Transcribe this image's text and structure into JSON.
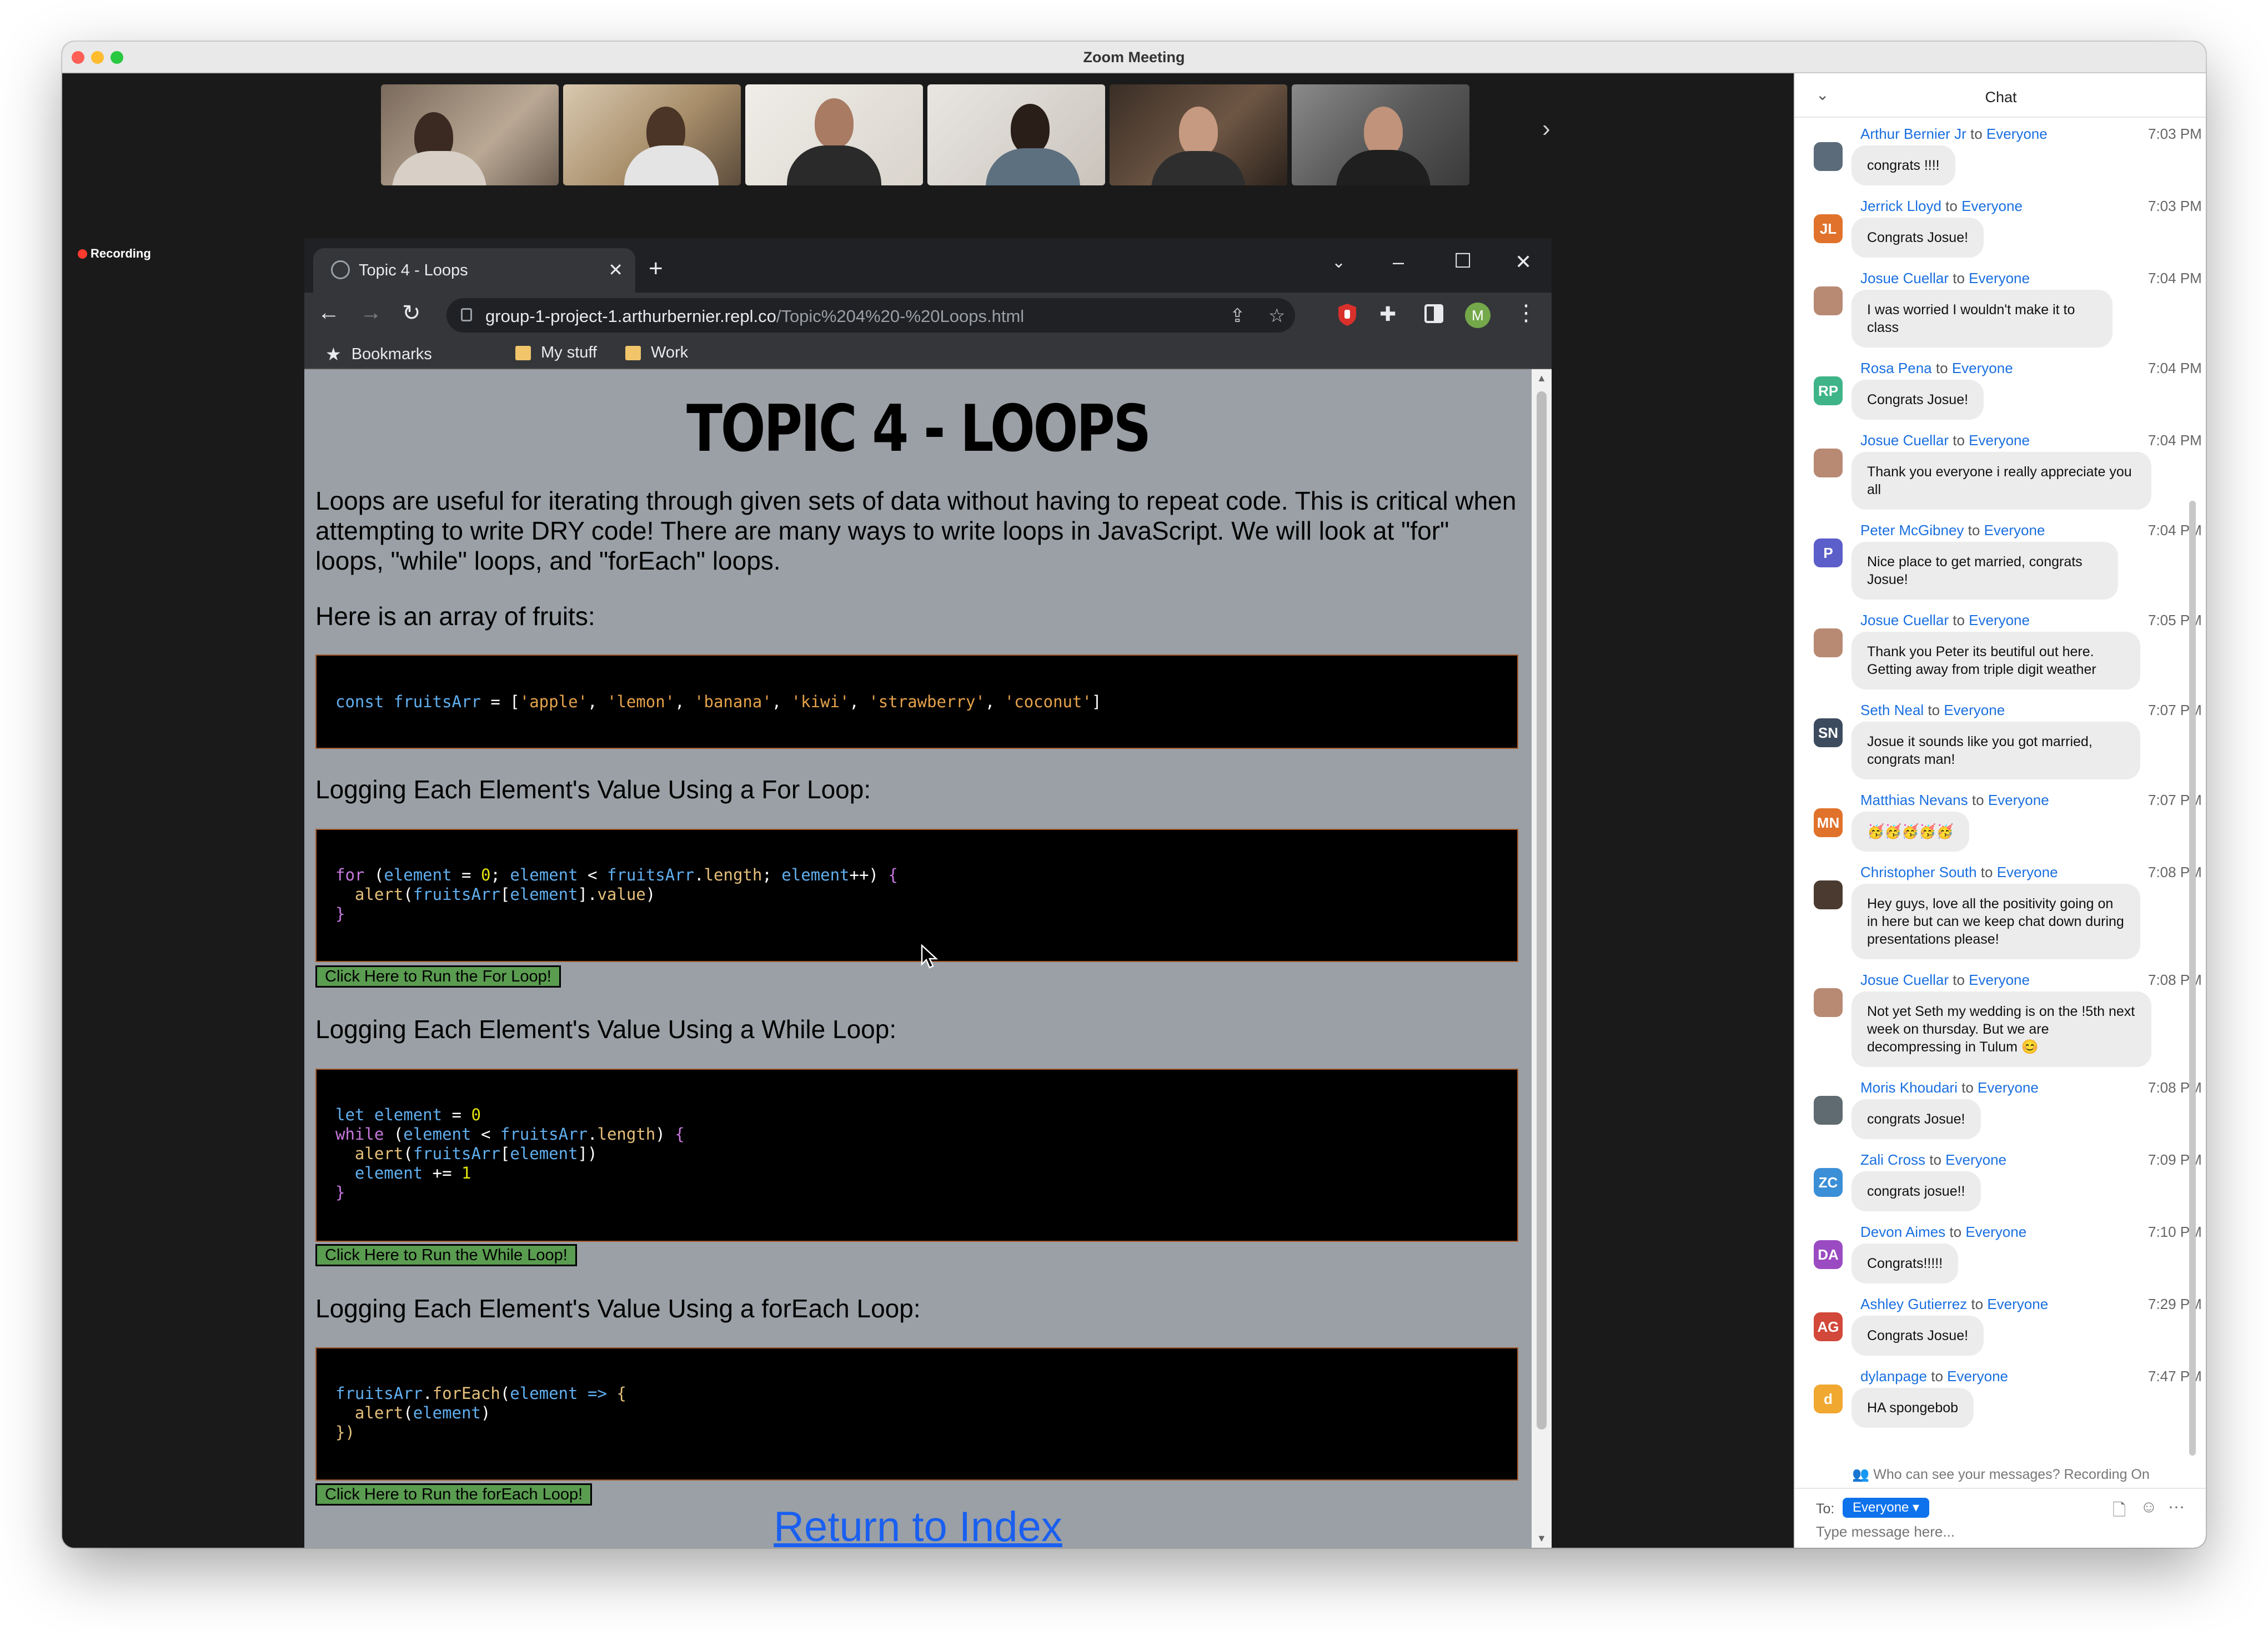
{
  "app": {
    "window_title": "Zoom Meeting",
    "recording_label": "Recording"
  },
  "participants_next": "›",
  "browser": {
    "tab_title": "Topic 4 - Loops",
    "tab_close": "✕",
    "new_tab": "+",
    "url_host": "group-1-project-1.arthurbernier.repl.co",
    "url_path": "/Topic%204%20-%20Loops.html",
    "profile_initial": "M",
    "bookmarks": [
      {
        "label": "Bookmarks"
      },
      {
        "label": "My stuff"
      },
      {
        "label": "Work"
      }
    ]
  },
  "page": {
    "title": "TOPIC 4 - LOOPS",
    "intro": "Loops are useful for iterating through given sets of data without having to repeat code. This is critical when attempting to write DRY code! There are many ways to write loops in JavaScript. We will look at \"for\" loops, \"while\" loops, and \"forEach\" loops.",
    "array_heading": "Here is an array of fruits:",
    "array_code": {
      "kw": "const",
      "var": "fruitsArr",
      "eq": " = [",
      "items": [
        "'apple'",
        "'lemon'",
        "'banana'",
        "'kiwi'",
        "'strawberry'",
        "'coconut'"
      ],
      "close": "]"
    },
    "for_heading": "Logging Each Element's Value Using a For Loop:",
    "for_button": "Click Here to Run the For Loop!",
    "while_heading": "Logging Each Element's Value Using a While Loop:",
    "while_button": "Click Here to Run the While Loop!",
    "foreach_heading": "Logging Each Element's Value Using a forEach Loop:",
    "foreach_button": "Click Here to Run the forEach Loop!",
    "return_link": "Return to Index"
  },
  "chat": {
    "title": "Chat",
    "notice": "Who can see your messages? Recording On",
    "to_label": "To:",
    "to_value": "Everyone ▾",
    "input_placeholder": "Type message here...",
    "messages": [
      {
        "sender": "Arthur Bernier Jr",
        "to": "to",
        "recipient": "Everyone",
        "time": "7:03 PM",
        "avatar": "",
        "avatar_color": "#5b6b7a",
        "text": "congrats !!!!"
      },
      {
        "sender": "Jerrick Lloyd",
        "to": "to",
        "recipient": "Everyone",
        "time": "7:03 PM",
        "avatar": "JL",
        "avatar_color": "#e0722b",
        "text": "Congrats Josue!"
      },
      {
        "sender": "Josue Cuellar",
        "to": "to",
        "recipient": "Everyone",
        "time": "7:04 PM",
        "avatar": "",
        "avatar_color": "#b88a74",
        "text": "I was worried I wouldn't make it to class"
      },
      {
        "sender": "Rosa Pena",
        "to": "to",
        "recipient": "Everyone",
        "time": "7:04 PM",
        "avatar": "RP",
        "avatar_color": "#3fb489",
        "text": "Congrats Josue!"
      },
      {
        "sender": "Josue Cuellar",
        "to": "to",
        "recipient": "Everyone",
        "time": "7:04 PM",
        "avatar": "",
        "avatar_color": "#b88a74",
        "text": "Thank you everyone i really appreciate you all"
      },
      {
        "sender": "Peter McGibney",
        "to": "to",
        "recipient": "Everyone",
        "time": "7:04 PM",
        "avatar": "P",
        "avatar_color": "#5c5ec9",
        "text": "Nice place to get married, congrats Josue!"
      },
      {
        "sender": "Josue Cuellar",
        "to": "to",
        "recipient": "Everyone",
        "time": "7:05 PM",
        "avatar": "",
        "avatar_color": "#b88a74",
        "text": "Thank you Peter its beutiful out here. Getting away from triple digit weather"
      },
      {
        "sender": "Seth Neal",
        "to": "to",
        "recipient": "Everyone",
        "time": "7:07 PM",
        "avatar": "SN",
        "avatar_color": "#3c4b5e",
        "text": "Josue it sounds like you got married, congrats man!"
      },
      {
        "sender": "Matthias Nevans",
        "to": "to",
        "recipient": "Everyone",
        "time": "7:07 PM",
        "avatar": "MN",
        "avatar_color": "#e0722b",
        "text": "🥳🥳🥳🥳🥳"
      },
      {
        "sender": "Christopher South",
        "to": "to",
        "recipient": "Everyone",
        "time": "7:08 PM",
        "avatar": "",
        "avatar_color": "#4a3a30",
        "text": "Hey guys, love all the positivity going on in here but can we keep chat down during presentations please!"
      },
      {
        "sender": "Josue Cuellar",
        "to": "to",
        "recipient": "Everyone",
        "time": "7:08 PM",
        "avatar": "",
        "avatar_color": "#b88a74",
        "text": "Not yet Seth my wedding is on the !5th next week on thursday. But we are decompressing in Tulum 😊"
      },
      {
        "sender": "Moris Khoudari",
        "to": "to",
        "recipient": "Everyone",
        "time": "7:08 PM",
        "avatar": "",
        "avatar_color": "#5f6b70",
        "text": "congrats Josue!"
      },
      {
        "sender": "Zali Cross",
        "to": "to",
        "recipient": "Everyone",
        "time": "7:09 PM",
        "avatar": "ZC",
        "avatar_color": "#3b8fd6",
        "text": "congrats josue!!"
      },
      {
        "sender": "Devon Aimes",
        "to": "to",
        "recipient": "Everyone",
        "time": "7:10 PM",
        "avatar": "DA",
        "avatar_color": "#9b4bc2",
        "text": "Congrats!!!!!"
      },
      {
        "sender": "Ashley Gutierrez",
        "to": "to",
        "recipient": "Everyone",
        "time": "7:29 PM",
        "avatar": "AG",
        "avatar_color": "#d2483a",
        "text": "Congrats Josue!"
      },
      {
        "sender": "dylanpage",
        "to": "to",
        "recipient": "Everyone",
        "time": "7:47 PM",
        "avatar": "d",
        "avatar_color": "#f0a830",
        "text": "HA spongebob"
      }
    ]
  }
}
